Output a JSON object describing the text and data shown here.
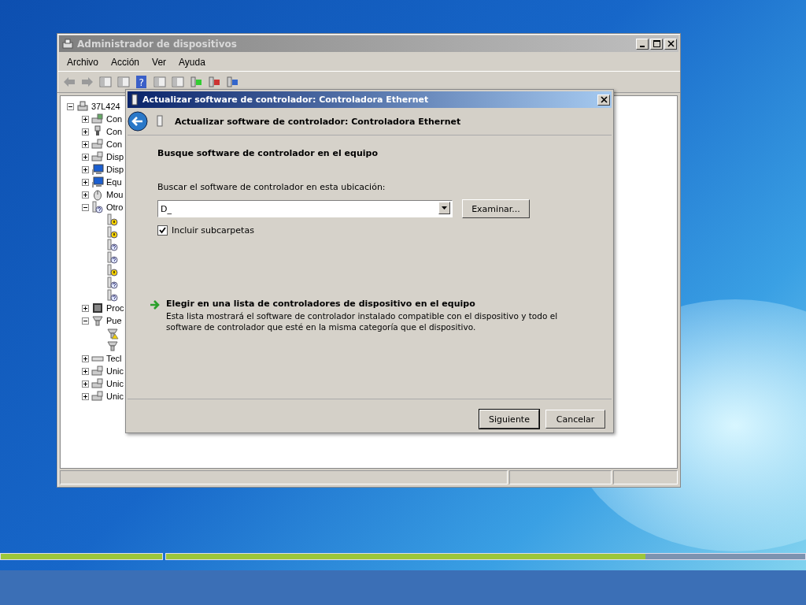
{
  "device_manager": {
    "title": "Administrador de dispositivos",
    "menu": [
      "Archivo",
      "Acción",
      "Ver",
      "Ayuda"
    ],
    "help_glyph": "?",
    "tree": {
      "label": "37L424",
      "kind": "computer",
      "expanded": true,
      "children": [
        {
          "label": "Con",
          "kind": "card",
          "expanded": false
        },
        {
          "label": "Con",
          "kind": "usb",
          "expanded": false
        },
        {
          "label": "Con",
          "kind": "storage",
          "expanded": false
        },
        {
          "label": "Disp",
          "kind": "devices",
          "expanded": false
        },
        {
          "label": "Disp",
          "kind": "monitor",
          "expanded": false
        },
        {
          "label": "Equ",
          "kind": "monitor",
          "expanded": false
        },
        {
          "label": "Mou",
          "kind": "mouse",
          "expanded": false
        },
        {
          "label": "Otro",
          "kind": "unknown",
          "expanded": true,
          "children": [
            {
              "kind": "warning"
            },
            {
              "kind": "warning"
            },
            {
              "kind": "unknown"
            },
            {
              "kind": "unknown"
            },
            {
              "kind": "warning"
            },
            {
              "kind": "unknown"
            },
            {
              "kind": "unknown"
            }
          ]
        },
        {
          "label": "Proc",
          "kind": "chip",
          "expanded": false
        },
        {
          "label": "Pue",
          "kind": "port",
          "expanded": true,
          "children": [
            {
              "kind": "port-warning"
            },
            {
              "kind": "port"
            }
          ]
        },
        {
          "label": "Tecl",
          "kind": "keyboard",
          "expanded": false
        },
        {
          "label": "Unic",
          "kind": "drive",
          "expanded": false
        },
        {
          "label": "Unic",
          "kind": "drive",
          "expanded": false
        },
        {
          "label": "Unic",
          "kind": "disc",
          "expanded": false
        }
      ]
    }
  },
  "dialog": {
    "title": "Actualizar software de controlador: Controladora Ethernet",
    "header": "Actualizar software de controlador: Controladora Ethernet",
    "heading": "Busque software de controlador en el equipo",
    "location_label": "Buscar el software de controlador en esta ubicación:",
    "location_value": "D_",
    "browse_button": "Examinar...",
    "include_subfolders": {
      "label": "Incluir subcarpetas",
      "checked": true
    },
    "pick_link": {
      "title": "Elegir en una lista de controladores de dispositivo en el equipo",
      "description": "Esta lista mostrará el software de controlador instalado compatible con el dispositivo y todo el software de controlador que esté en la misma categoría que el dispositivo."
    },
    "buttons": [
      {
        "label": "Siguiente",
        "default": true
      },
      {
        "label": "Cancelar",
        "default": false
      }
    ]
  },
  "setup_progress": [
    {
      "level": 1
    },
    {
      "level": 0.75
    }
  ]
}
